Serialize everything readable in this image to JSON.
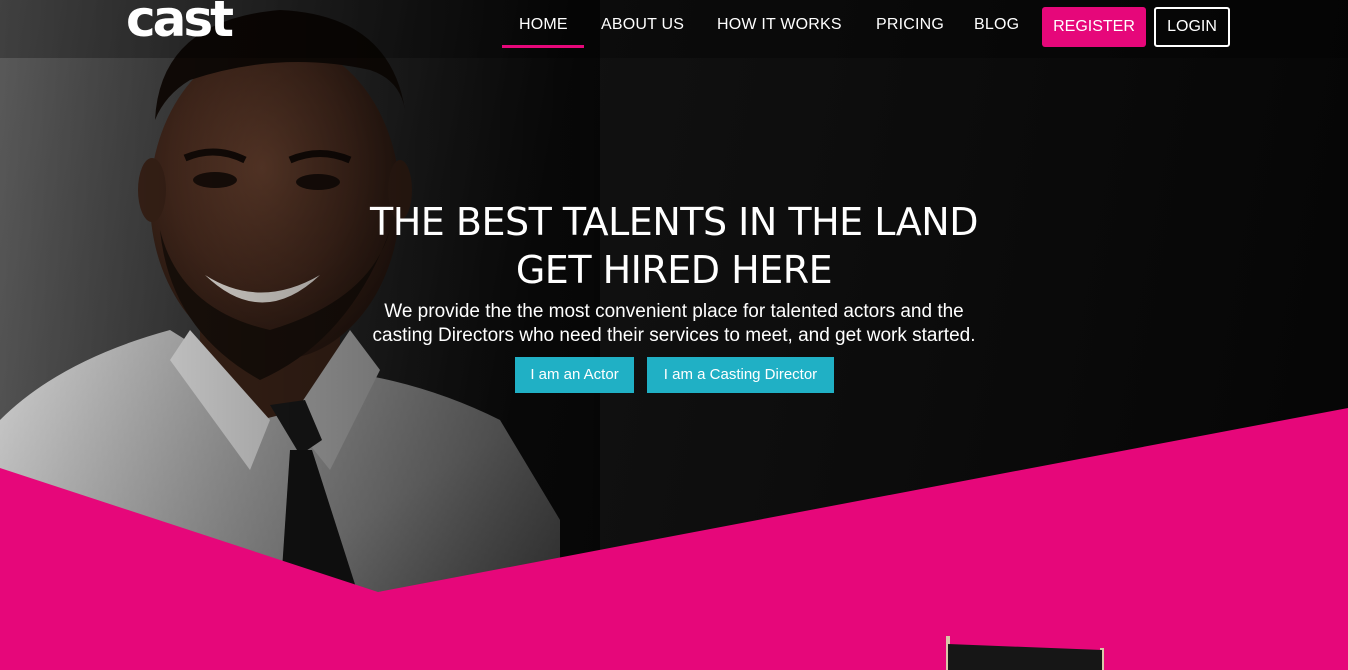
{
  "brand": {
    "logo_text": "cast"
  },
  "nav": {
    "items": [
      {
        "label": "HOME",
        "active": true
      },
      {
        "label": "ABOUT US",
        "active": false
      },
      {
        "label": "HOW IT WORKS",
        "active": false
      },
      {
        "label": "PRICING",
        "active": false
      },
      {
        "label": "BLOG",
        "active": false
      }
    ],
    "register_label": "REGISTER",
    "login_label": "LOGIN"
  },
  "hero": {
    "headline_line1": "THE BEST TALENTS IN THE LAND",
    "headline_line2": "GET HIRED HERE",
    "subtext_line1": "We provide the the most convenient place for talented actors and the",
    "subtext_line2": "casting Directors who need their services to meet, and get work started.",
    "cta_actor_label": "I am an Actor",
    "cta_director_label": "I am a Casting Director"
  },
  "colors": {
    "accent": "#e6077a",
    "cta": "#20b0c5",
    "background": "#0a0a0a",
    "text": "#ffffff"
  },
  "icons": {
    "chair": "directors-chair-icon"
  }
}
